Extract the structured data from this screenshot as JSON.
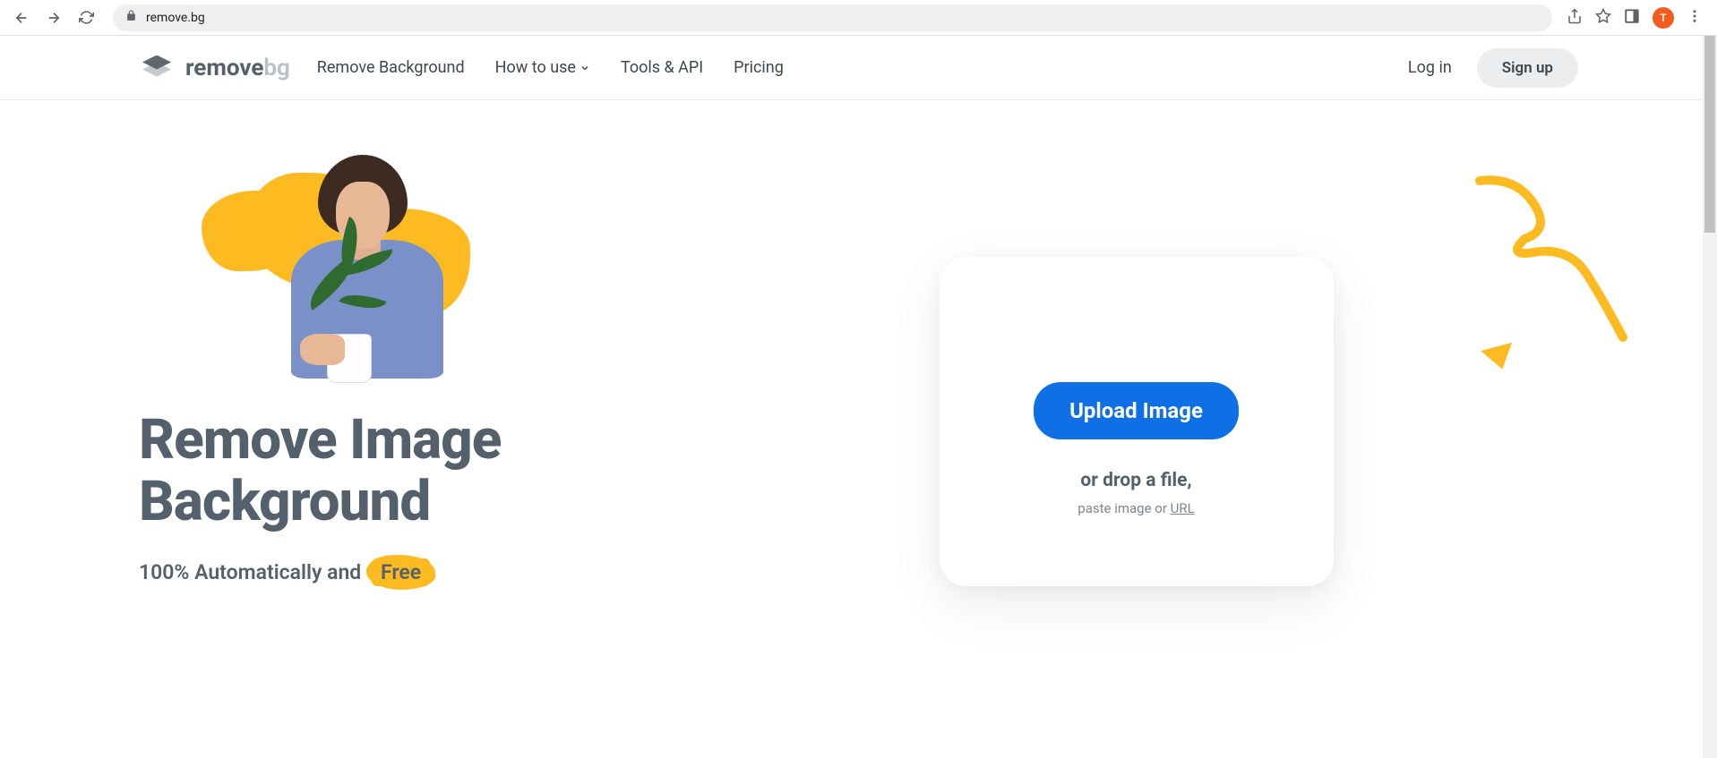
{
  "browser": {
    "url": "remove.bg",
    "avatar_letter": "T"
  },
  "header": {
    "logo_text_1": "remove",
    "logo_text_2": "bg",
    "nav": {
      "remove_bg": "Remove Background",
      "how_to": "How to use",
      "tools": "Tools & API",
      "pricing": "Pricing"
    },
    "login": "Log in",
    "signup": "Sign up"
  },
  "hero": {
    "title": "Remove Image Background",
    "subtitle_prefix": "100% Automatically and",
    "subtitle_badge": "Free"
  },
  "upload": {
    "button": "Upload Image",
    "drop_text": "or drop a file,",
    "paste_prefix": "paste image or ",
    "paste_link": "URL"
  }
}
